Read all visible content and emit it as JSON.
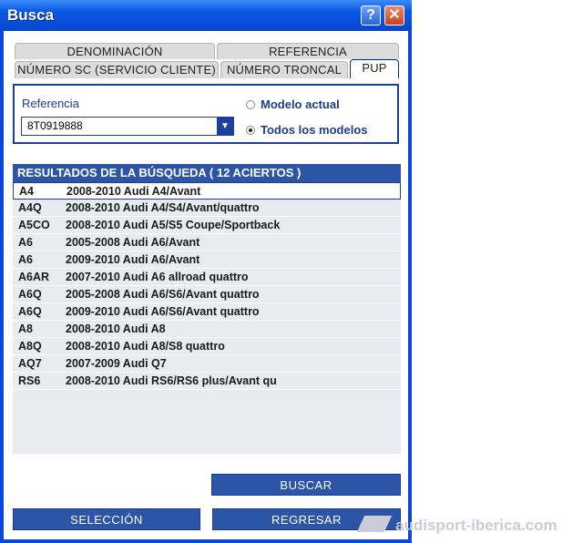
{
  "window": {
    "title": "Busca"
  },
  "tabs": {
    "row1": [
      "DENOMINACIÓN",
      "REFERENCIA"
    ],
    "row2": [
      "NÚMERO SC (SERVICIO CLIENTE)",
      "NÚMERO TRONCAL",
      "PUP"
    ],
    "active": "PUP"
  },
  "search": {
    "reference_label": "Referencia",
    "reference_value": "8T0919888",
    "radio_current": "Modelo actual",
    "radio_all": "Todos los modelos",
    "selected_radio": "Todos los modelos"
  },
  "results": {
    "header": "RESULTADOS DE LA BÚSQUEDA  ( 12 ACIERTOS )",
    "rows": [
      {
        "code": "A4",
        "desc": "2008-2010 Audi A4/Avant"
      },
      {
        "code": "A4Q",
        "desc": "2008-2010 Audi A4/S4/Avant/quattro"
      },
      {
        "code": "A5CO",
        "desc": "2008-2010 Audi A5/S5 Coupe/Sportback"
      },
      {
        "code": "A6",
        "desc": "2005-2008 Audi A6/Avant"
      },
      {
        "code": "A6",
        "desc": "2009-2010 Audi A6/Avant"
      },
      {
        "code": "A6AR",
        "desc": "2007-2010 Audi A6 allroad quattro"
      },
      {
        "code": "A6Q",
        "desc": "2005-2008 Audi A6/S6/Avant quattro"
      },
      {
        "code": "A6Q",
        "desc": "2009-2010 Audi A6/S6/Avant quattro"
      },
      {
        "code": "A8",
        "desc": "2008-2010 Audi A8"
      },
      {
        "code": "A8Q",
        "desc": "2008-2010 Audi A8/S8 quattro"
      },
      {
        "code": "AQ7",
        "desc": "2007-2009 Audi Q7"
      },
      {
        "code": "RS6",
        "desc": "2008-2010 Audi RS6/RS6 plus/Avant qu"
      }
    ]
  },
  "buttons": {
    "buscar": "BUSCAR",
    "seleccion": "SELECCIÓN",
    "regresar": "REGRESAR"
  },
  "watermark": "audisport-iberica.com"
}
